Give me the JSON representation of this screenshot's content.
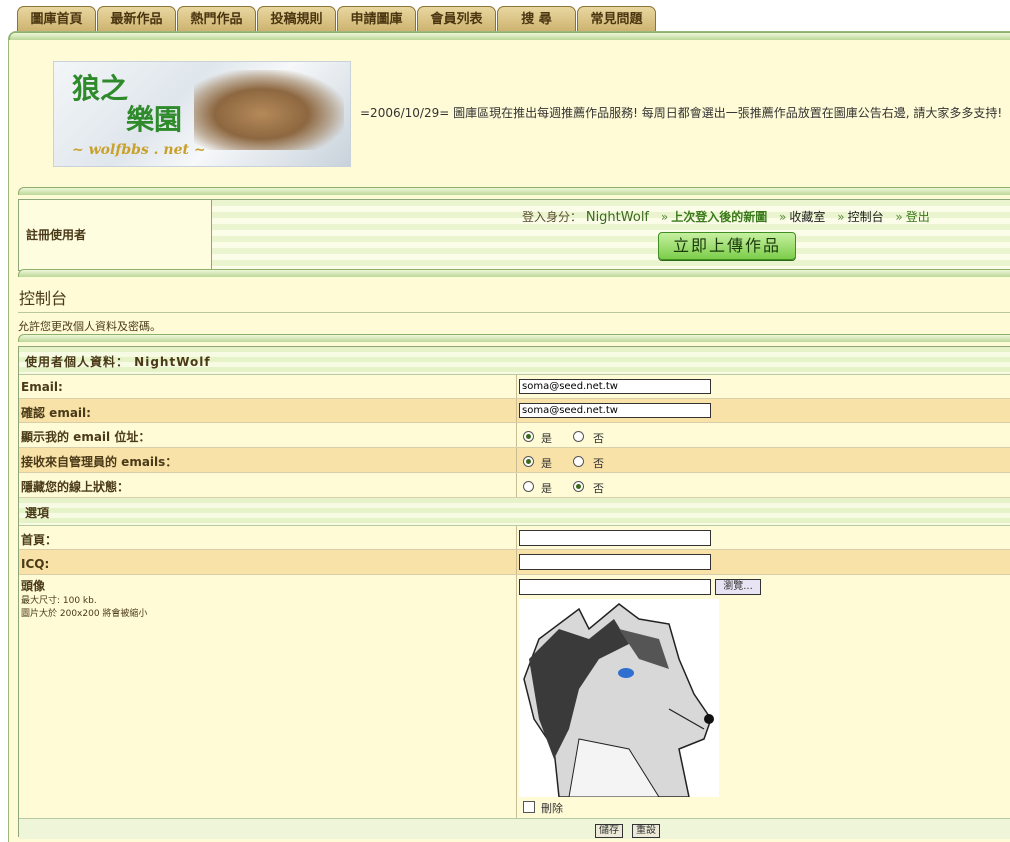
{
  "tabs": [
    "圖庫首頁",
    "最新作品",
    "熱門作品",
    "投稿規則",
    "申請圖庫",
    "會員列表",
    "搜 尋",
    "常見問題"
  ],
  "logo": {
    "line1": "狼之",
    "line2": "樂園",
    "site": "~ wolfbbs . net ~"
  },
  "announcement": "=2006/10/29= 圖庫區現在推出每週推薦作品服務! 每周日都會選出一張推薦作品放置在圖庫公告右邊, 請大家多多支持!",
  "login": {
    "role": "註冊使用者",
    "identity_label": "登入身分：",
    "username": "NightWolf",
    "sep": "»",
    "new_since": "上次登入後的新圖",
    "favorites": "收藏室",
    "control_panel": "控制台",
    "logout": "登出",
    "upload_button": "立即上傳作品"
  },
  "control_panel": {
    "title": "控制台",
    "description": "允許您更改個人資料及密碼。",
    "profile_header": "使用者個人資料： NightWolf",
    "fields": {
      "email_label": "Email:",
      "email_value": "soma@seed.net.tw",
      "confirm_email_label": "確認 email:",
      "confirm_email_value": "soma@seed.net.tw",
      "show_email_label": "顯示我的 email 位址：",
      "receive_admin_label": "接收來自管理員的 emails：",
      "hide_online_label": "隱藏您的線上狀態："
    },
    "radio_yes": "是",
    "radio_no": "否",
    "options_header": "選項",
    "homepage_label": "首頁：",
    "icq_label": "ICQ:",
    "avatar_label": "頭像",
    "avatar_note1": "最大尺寸: 100 kb.",
    "avatar_note2": "圖片大於 200x200 將會被縮小",
    "browse_button": "瀏覽...",
    "delete_label": "刪除",
    "save_button": "儲存",
    "reset_button": "重設"
  },
  "radio_state": {
    "show_email": "yes",
    "receive_admin": "yes",
    "hide_online": "no"
  }
}
